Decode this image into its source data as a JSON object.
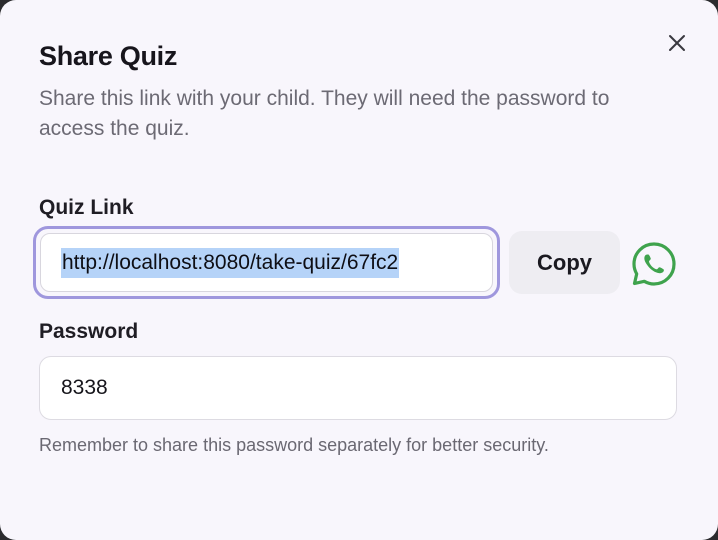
{
  "dialog": {
    "title": "Share Quiz",
    "description": "Share this link with your child. They will need the password to access the quiz.",
    "close_icon": "close-icon"
  },
  "quiz_link": {
    "label": "Quiz Link",
    "value": "http://localhost:8080/take-quiz/67fc2",
    "selected": true,
    "copy_label": "Copy",
    "share_icon": "whatsapp-icon",
    "share_icon_color": "#3fa34d"
  },
  "password": {
    "label": "Password",
    "value": "8338",
    "hint": "Remember to share this password separately for better security."
  },
  "colors": {
    "focus_ring": "#9f97dd",
    "selection": "#b5d3f8",
    "dialog_bg": "#f8f6fc"
  }
}
